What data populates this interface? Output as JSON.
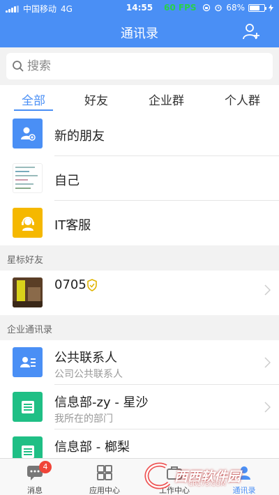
{
  "status_bar": {
    "carrier": "中国移动",
    "network": "4G",
    "time": "14:55",
    "fps": "60 FPS",
    "battery_text": "68%",
    "battery_level": 0.68
  },
  "header": {
    "title": "通讯录",
    "add_icon": "add-user-icon"
  },
  "search": {
    "placeholder": "搜索"
  },
  "tabs": [
    "全部",
    "好友",
    "企业群",
    "个人群"
  ],
  "top_items": [
    {
      "label": "新的朋友",
      "icon": "new-friend-icon"
    },
    {
      "label": "自己",
      "icon": "self-thumbnail"
    },
    {
      "label": "IT客服",
      "icon": "support-icon"
    }
  ],
  "starred": {
    "header": "星标好友",
    "items": [
      {
        "label": "0705",
        "icon": "verified-badge-icon"
      }
    ]
  },
  "enterprise": {
    "header": "企业通讯录",
    "items": [
      {
        "label": "公共联系人",
        "sub": "公司公共联系人"
      },
      {
        "label": "信息部-zy - 星沙",
        "sub": "我所在的部门"
      },
      {
        "label": "信息部 - 榔梨",
        "sub": ""
      }
    ]
  },
  "tabbar": {
    "items": [
      {
        "label": "消息",
        "badge": "4"
      },
      {
        "label": "应用中心"
      },
      {
        "label": "工作中心"
      },
      {
        "label": "通讯录"
      }
    ]
  },
  "watermark": {
    "text": "西西软件园",
    "url": "CR173.COM"
  },
  "colors": {
    "primary": "#4a8ff5",
    "green": "#1fbf85",
    "yellow": "#f5b800",
    "badge": "#f04438"
  }
}
